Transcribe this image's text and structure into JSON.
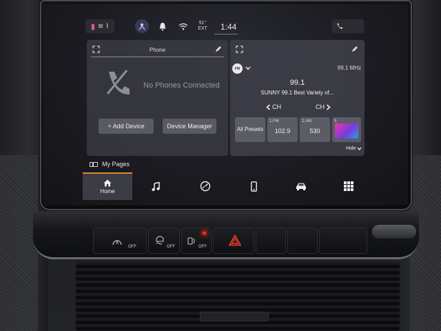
{
  "status": {
    "temperature": "91°",
    "temperature_label": "EXT",
    "time": "1:44"
  },
  "phone_card": {
    "title": "Phone",
    "message": "No Phones Connected",
    "add_device": "+ Add Device",
    "device_manager": "Device Manager"
  },
  "radio_card": {
    "band": "FM",
    "frequency": "99.1 MHz",
    "station_number": "99.1",
    "station_text": "SUNNY 99.1 Best Variety of...",
    "ch_prev": "CH",
    "ch_next": "CH",
    "all_presets": "All Presets",
    "presets": [
      {
        "label": "1.FM",
        "value": "102.9"
      },
      {
        "label": "2.AM",
        "value": "530"
      },
      {
        "label": "3",
        "value": ""
      }
    ],
    "hide": "Hide"
  },
  "my_pages": "My Pages",
  "nav": {
    "home": "Home"
  },
  "hardware": {
    "off1": "OFF",
    "off2": "OFF",
    "off3": "OFF"
  },
  "colors": {
    "accent": "#e08a2a",
    "led": "#ff2a1a",
    "hazard": "#e23b2b"
  }
}
